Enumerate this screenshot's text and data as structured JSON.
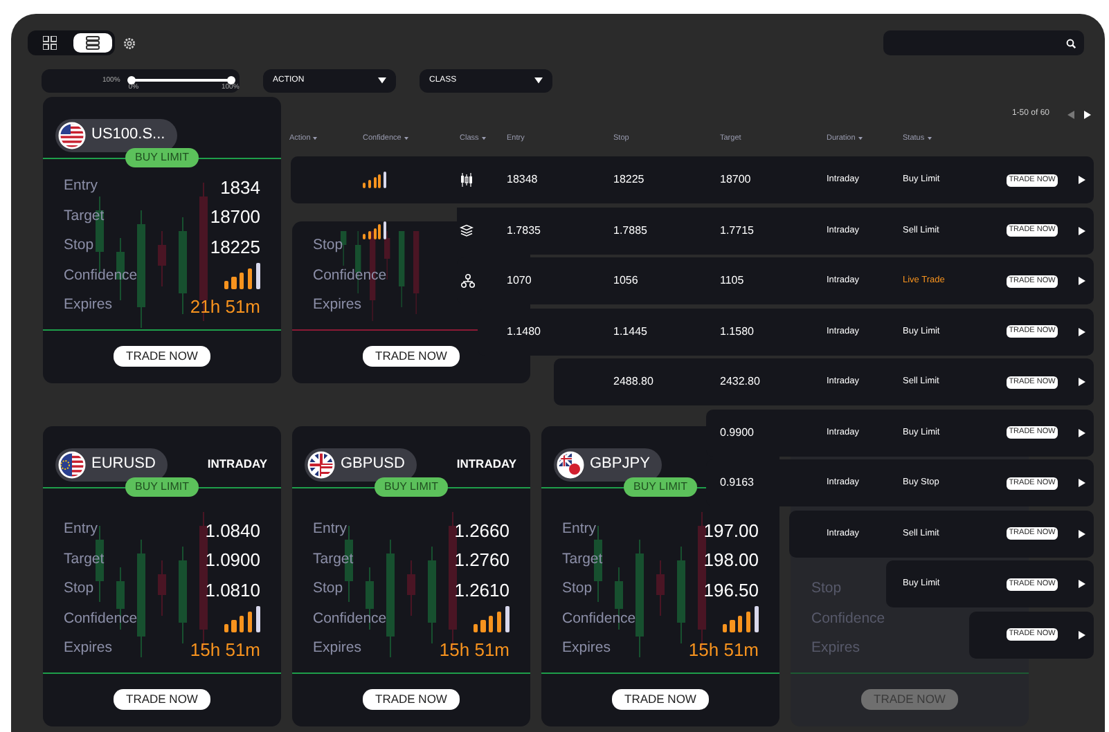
{
  "toolbar": {
    "views": [
      {
        "kind": "grid",
        "selected": false
      },
      {
        "kind": "list",
        "selected": true
      }
    ]
  },
  "filters": {
    "slider": {
      "label": "100%",
      "min_label": "0%",
      "max_label": "100%",
      "level": 1
    },
    "dropdowns": [
      {
        "label": "ACTION"
      },
      {
        "label": "CLASS"
      }
    ]
  },
  "pagination": {
    "text": "1-50 of 60",
    "prev_disabled": true,
    "next_disabled": false
  },
  "table": {
    "columns": [
      {
        "label": "Action",
        "sortable": true
      },
      {
        "label": "Confidence",
        "sortable": true
      },
      {
        "label": "Class",
        "sortable": true
      },
      {
        "label": "Entry",
        "sortable": false
      },
      {
        "label": "Stop",
        "sortable": false
      },
      {
        "label": "Target",
        "sortable": false
      },
      {
        "label": "Duration",
        "sortable": true
      },
      {
        "label": "Status",
        "sortable": true
      }
    ],
    "rows": [
      {
        "confidence": {
          "level": 0.8
        },
        "class": {
          "kind": "candles"
        },
        "entry": "18348",
        "stop": "18225",
        "target": "18700",
        "duration": "Intraday",
        "status": {
          "text": "Buy Limit",
          "color": "#ffffff"
        },
        "button": "TRADE NOW"
      },
      {
        "confidence": {
          "level": 0.8
        },
        "class": {
          "kind": "layers"
        },
        "entry": "1.7835",
        "stop": "1.7885",
        "target": "1.7715",
        "duration": "Intraday",
        "status": {
          "text": "Sell Limit",
          "color": "#ffffff"
        },
        "button": "TRADE NOW"
      },
      {
        "class": {
          "kind": "network"
        },
        "entry": "1070",
        "stop": "1056",
        "target": "1105",
        "duration": "Intraday",
        "status": {
          "text": "Live Trade",
          "color": "#f7931e"
        },
        "button": "TRADE NOW"
      },
      {
        "entry": "1.1480",
        "stop": "1.1445",
        "target": "1.1580",
        "duration": "Intraday",
        "status": {
          "text": "Buy Limit",
          "color": "#ffffff"
        },
        "button": "TRADE NOW"
      },
      {
        "stop": "2488.80",
        "target": "2432.80",
        "duration": "Intraday",
        "status": {
          "text": "Sell Limit",
          "color": "#ffffff"
        },
        "button": "TRADE NOW"
      },
      {
        "target": "0.9900",
        "duration": "Intraday",
        "status": {
          "text": "Buy Limit",
          "color": "#ffffff"
        },
        "button": "TRADE NOW"
      },
      {
        "target": "0.9163",
        "duration": "Intraday",
        "status": {
          "text": "Buy Stop",
          "color": "#ffffff"
        },
        "button": "TRADE NOW"
      },
      {
        "duration": "Intraday",
        "status": {
          "text": "Sell Limit",
          "color": "#ffffff"
        },
        "button": "TRADE NOW"
      },
      {
        "status": {
          "text": "Buy Limit",
          "color": "#ffffff"
        },
        "button": "TRADE NOW"
      },
      {
        "button": "TRADE NOW"
      }
    ]
  },
  "cards": [
    {
      "pair": "US100.S...",
      "flag": {
        "kind": "us"
      },
      "action": "BUY LIMIT",
      "color": "#1e9e4a",
      "dimmed": false,
      "fields": [
        {
          "label": "Entry",
          "kind": "value",
          "value": "1834"
        },
        {
          "label": "Target",
          "kind": "value",
          "value": "18700"
        },
        {
          "label": "Stop",
          "kind": "value",
          "value": "18225"
        },
        {
          "label": "Confidence",
          "kind": "meter",
          "level": 0.8
        },
        {
          "label": "Expires",
          "kind": "time",
          "value": "21h 51m"
        }
      ],
      "button": {
        "label": "TRADE NOW",
        "disabled": false
      }
    },
    {
      "color": "#8b1a35",
      "dimmed": false,
      "fields": [
        {
          "label": "Stop",
          "kind": "value"
        },
        {
          "label": "Confidence",
          "kind": "meter"
        },
        {
          "label": "Expires",
          "kind": "time"
        }
      ],
      "button": {
        "label": "TRADE NOW",
        "disabled": false
      }
    },
    {
      "pair": "EURUSD",
      "flag": {
        "kind": "eu"
      },
      "duration": "INTRADAY",
      "action": "BUY LIMIT",
      "color": "#1e9e4a",
      "dimmed": false,
      "fields": [
        {
          "label": "Entry",
          "kind": "value",
          "value": "1.0840"
        },
        {
          "label": "Target",
          "kind": "value",
          "value": "1.0900"
        },
        {
          "label": "Stop",
          "kind": "value",
          "value": "1.0810"
        },
        {
          "label": "Confidence",
          "kind": "meter",
          "level": 0.8
        },
        {
          "label": "Expires",
          "kind": "time",
          "value": "15h 51m"
        }
      ],
      "button": {
        "label": "TRADE NOW",
        "disabled": false
      }
    },
    {
      "pair": "GBPUSD",
      "flag": {
        "kind": "gb"
      },
      "duration": "INTRADAY",
      "action": "BUY LIMIT",
      "color": "#1e9e4a",
      "dimmed": false,
      "fields": [
        {
          "label": "Entry",
          "kind": "value",
          "value": "1.2660"
        },
        {
          "label": "Target",
          "kind": "value",
          "value": "1.2760"
        },
        {
          "label": "Stop",
          "kind": "value",
          "value": "1.2610"
        },
        {
          "label": "Confidence",
          "kind": "meter",
          "level": 0.8
        },
        {
          "label": "Expires",
          "kind": "time",
          "value": "15h 51m"
        }
      ],
      "button": {
        "label": "TRADE NOW",
        "disabled": false
      }
    },
    {
      "pair": "GBPJPY",
      "flag": {
        "kind": "gbjp"
      },
      "action": "BUY LIMIT",
      "color": "#1e9e4a",
      "dimmed": false,
      "fields": [
        {
          "label": "Entry",
          "kind": "value",
          "value": "197.00"
        },
        {
          "label": "Target",
          "kind": "value",
          "value": "198.00"
        },
        {
          "label": "Stop",
          "kind": "value",
          "value": "196.50"
        },
        {
          "label": "Confidence",
          "kind": "meter",
          "level": 0.8
        },
        {
          "label": "Expires",
          "kind": "time",
          "value": "15h 51m"
        }
      ],
      "button": {
        "label": "TRADE NOW",
        "disabled": false
      }
    },
    {
      "color": "#1d5a33",
      "dimmed": true,
      "fields": [
        {
          "label": "Stop",
          "kind": "value"
        },
        {
          "label": "Confidence",
          "kind": "meter"
        },
        {
          "label": "Expires",
          "kind": "time"
        }
      ],
      "button": {
        "label": "TRADE NOW",
        "disabled": true
      }
    }
  ]
}
